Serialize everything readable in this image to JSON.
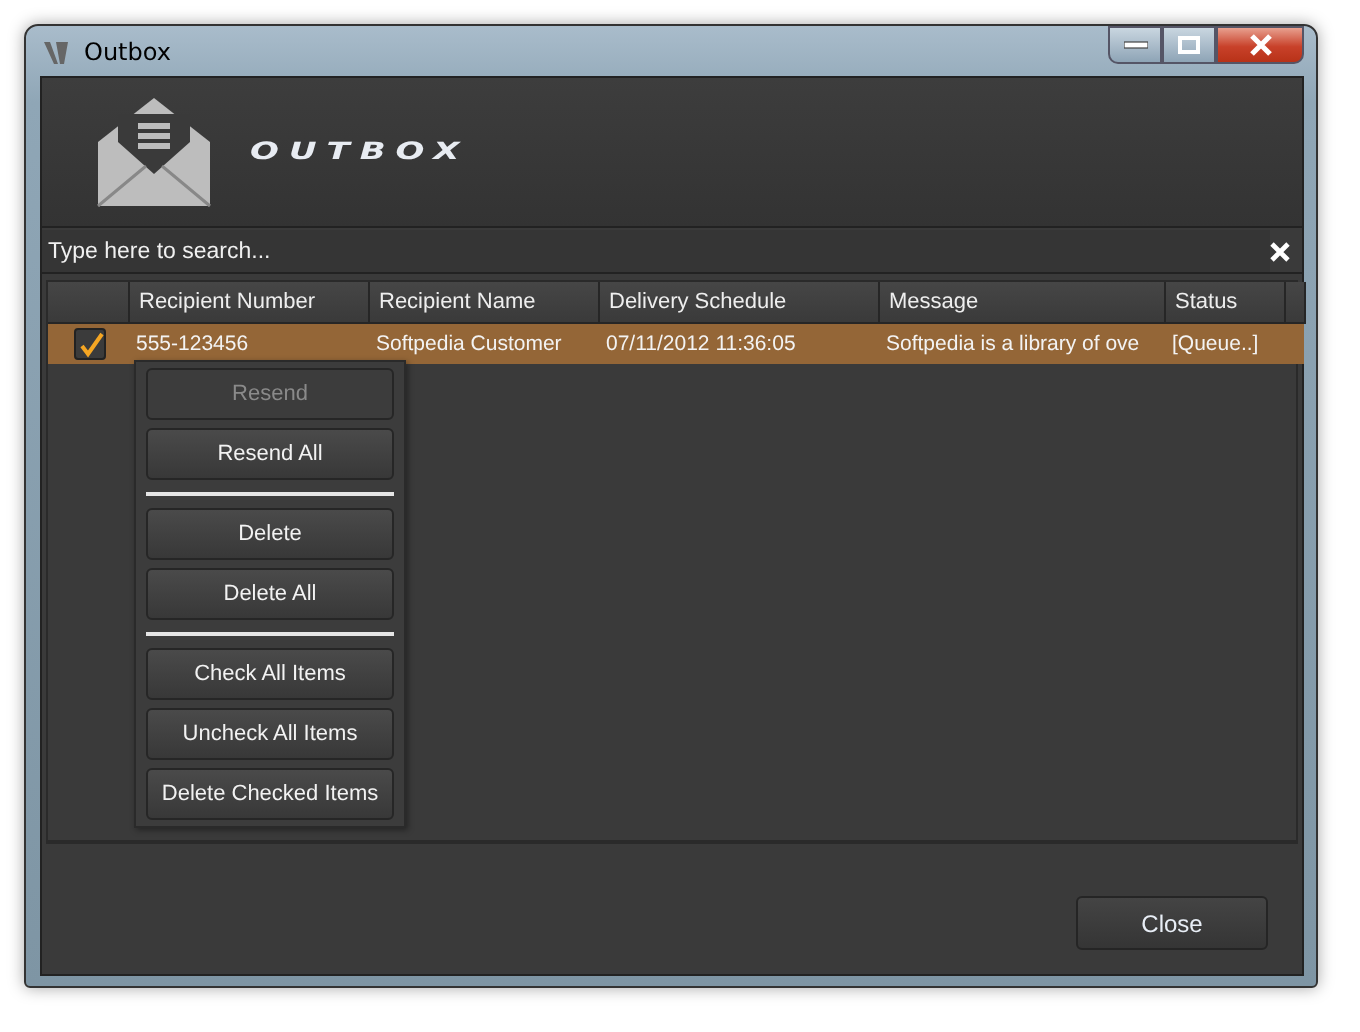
{
  "window": {
    "title": "Outbox"
  },
  "header": {
    "logo_text": "OUTBOX"
  },
  "search": {
    "placeholder": "Type here to search..."
  },
  "table": {
    "columns": [
      "Recipient Number",
      "Recipient Name",
      "Delivery Schedule",
      "Message",
      "Status"
    ],
    "rows": [
      {
        "checked": true,
        "selected": true,
        "cells": [
          "555-123456",
          "Softpedia Customer",
          "07/11/2012 11:36:05",
          "Softpedia is a library of ove",
          "[Queue..]"
        ]
      }
    ]
  },
  "context_menu": {
    "items": [
      {
        "kind": "button",
        "label": "Resend",
        "disabled": true
      },
      {
        "kind": "button",
        "label": "Resend All",
        "disabled": false
      },
      {
        "kind": "separator"
      },
      {
        "kind": "button",
        "label": "Delete",
        "disabled": false
      },
      {
        "kind": "button",
        "label": "Delete All",
        "disabled": false
      },
      {
        "kind": "separator"
      },
      {
        "kind": "button",
        "label": "Check All Items",
        "disabled": false
      },
      {
        "kind": "button",
        "label": "Uncheck All Items",
        "disabled": false
      },
      {
        "kind": "button",
        "label": "Delete Checked Items",
        "disabled": false
      }
    ]
  },
  "buttons": [
    "Close"
  ]
}
